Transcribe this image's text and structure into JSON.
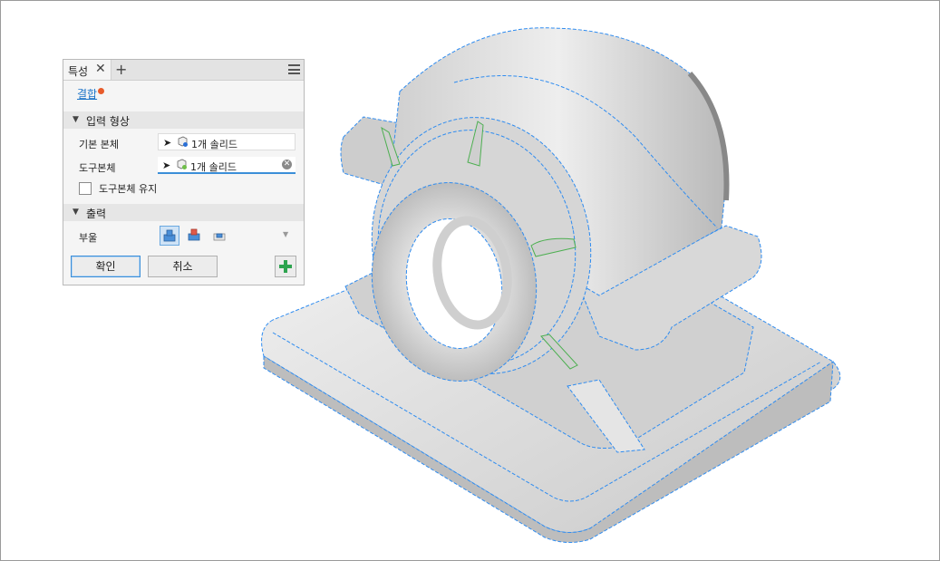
{
  "panel": {
    "tab_label": "특성",
    "tab_close_icon": "close-icon",
    "tab_add_icon": "plus-icon",
    "menu_icon": "hamburger-menu-icon",
    "feature_link": "결합",
    "input_section": {
      "title": "입력 형상",
      "base_body_label": "기본 본체",
      "base_body_value": "1개 솔리드",
      "tool_body_label": "도구본체",
      "tool_body_value": "1개 솔리드",
      "keep_tool_label": "도구본체 유지",
      "keep_tool_checked": false
    },
    "output_section": {
      "title": "출력",
      "operation_label": "부울",
      "operations": [
        "join-icon",
        "cut-icon",
        "intersect-icon"
      ],
      "selected_operation": 0
    },
    "buttons": {
      "ok": "확인",
      "cancel": "취소",
      "add": "+"
    }
  },
  "colors": {
    "accent": "#3b8ed8",
    "edge_highlight": "#2f8cf0",
    "status_dot": "#e85b2a",
    "model_fill": "#d9d9d9"
  },
  "viewport": {
    "model": "pillow-block-bearing-housing"
  }
}
